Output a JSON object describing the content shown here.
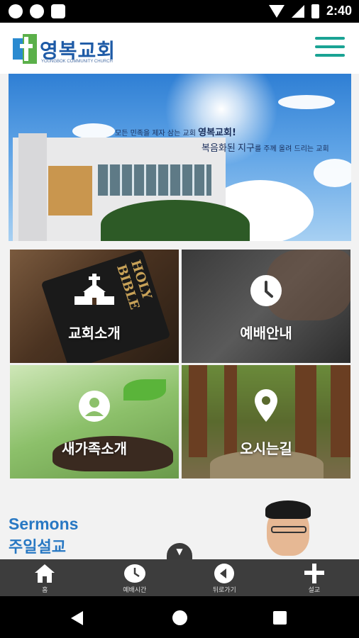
{
  "status_bar": {
    "time": "2:40",
    "left_icons": [
      "notification-icon",
      "record-icon",
      "sd-card-icon"
    ],
    "right_icons": [
      "wifi-icon",
      "signal-icon",
      "battery-icon"
    ]
  },
  "header": {
    "logo_title": "영복교회",
    "logo_subtitle": "YOUNGBOK COMMUNITY CHURCH",
    "menu_icon": "hamburger-menu-icon",
    "accent_color": "#1aa394",
    "brand_color": "#1d5aa6"
  },
  "banner": {
    "slogan_line1_prefix": "모든 민족을 제자 삼는 교회",
    "slogan_line1_bold": "영복교회!",
    "slogan_line2_prefix": "복음화된",
    "slogan_line2_mid": "지구",
    "slogan_line2_suffix": "를 주께 올려 드리는 교회"
  },
  "tiles": [
    {
      "label": "교회소개",
      "icon": "church-icon"
    },
    {
      "label": "예배안내",
      "icon": "clock-icon"
    },
    {
      "label": "새가족소개",
      "icon": "person-icon"
    },
    {
      "label": "오시는길",
      "icon": "location-pin-icon"
    }
  ],
  "sermons": {
    "title_en": "Sermons",
    "title_ko": "주일설교",
    "color": "#2878c3"
  },
  "bottom_nav": [
    {
      "label": "홈",
      "icon": "home-icon"
    },
    {
      "label": "예배시간",
      "icon": "clock-icon"
    },
    {
      "label": "뒤로가기",
      "icon": "back-arrow-icon"
    },
    {
      "label": "설교",
      "icon": "plus-icon"
    }
  ],
  "collapse_icon": "chevron-down-icon"
}
